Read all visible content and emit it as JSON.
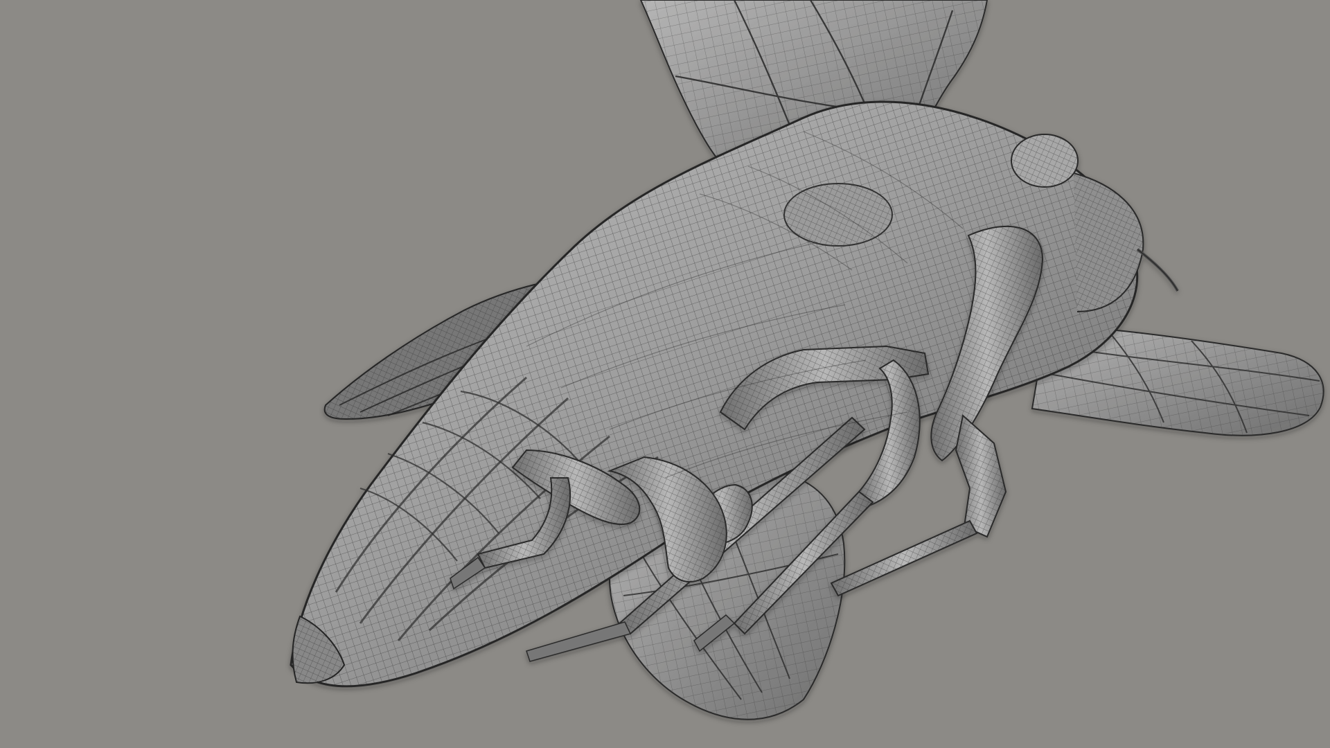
{
  "viewport": {
    "background_color": "#8c8a86",
    "model_base_color": "#8a8a8a",
    "model_highlight_color": "#b5b5b5",
    "model_shadow_color": "#555555",
    "wireframe_color": "#2a2a2a",
    "object_icon": "insect-mesh-icon"
  }
}
